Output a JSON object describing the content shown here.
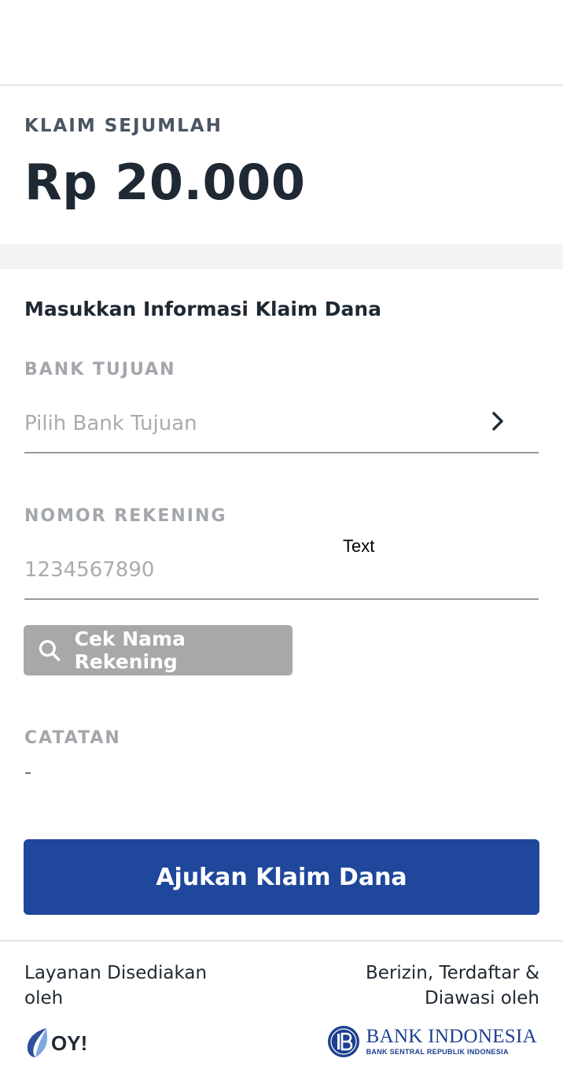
{
  "claim": {
    "label": "KLAIM SEJUMLAH",
    "amount": "Rp 20.000"
  },
  "form": {
    "title": "Masukkan Informasi Klaim Dana",
    "bank": {
      "label": "BANK TUJUAN",
      "placeholder": "Pilih Bank Tujuan",
      "icon": "chevron-right-icon"
    },
    "account": {
      "label": "NOMOR REKENING",
      "placeholder": "1234567890"
    },
    "overlay_text": "Text",
    "check_button": {
      "label": "Cek Nama Rekening",
      "icon": "search-icon"
    },
    "note": {
      "label": "CATATAN",
      "value": "-"
    },
    "submit_label": "Ajukan Klaim Dana"
  },
  "footer": {
    "left_text": "Layanan Disediakan oleh",
    "right_text": "Berizin, Terdaftar & Diawasi oleh",
    "provider_logo": "OY!",
    "regulator_name": "BANK INDONESIA",
    "regulator_sub": "BANK SENTRAL REPUBLIK INDONESIA"
  },
  "colors": {
    "primary": "#1f479b",
    "disabled_button": "#a6a8aa",
    "label_gray": "#a3a7ab",
    "text_dark": "#1f2933"
  }
}
